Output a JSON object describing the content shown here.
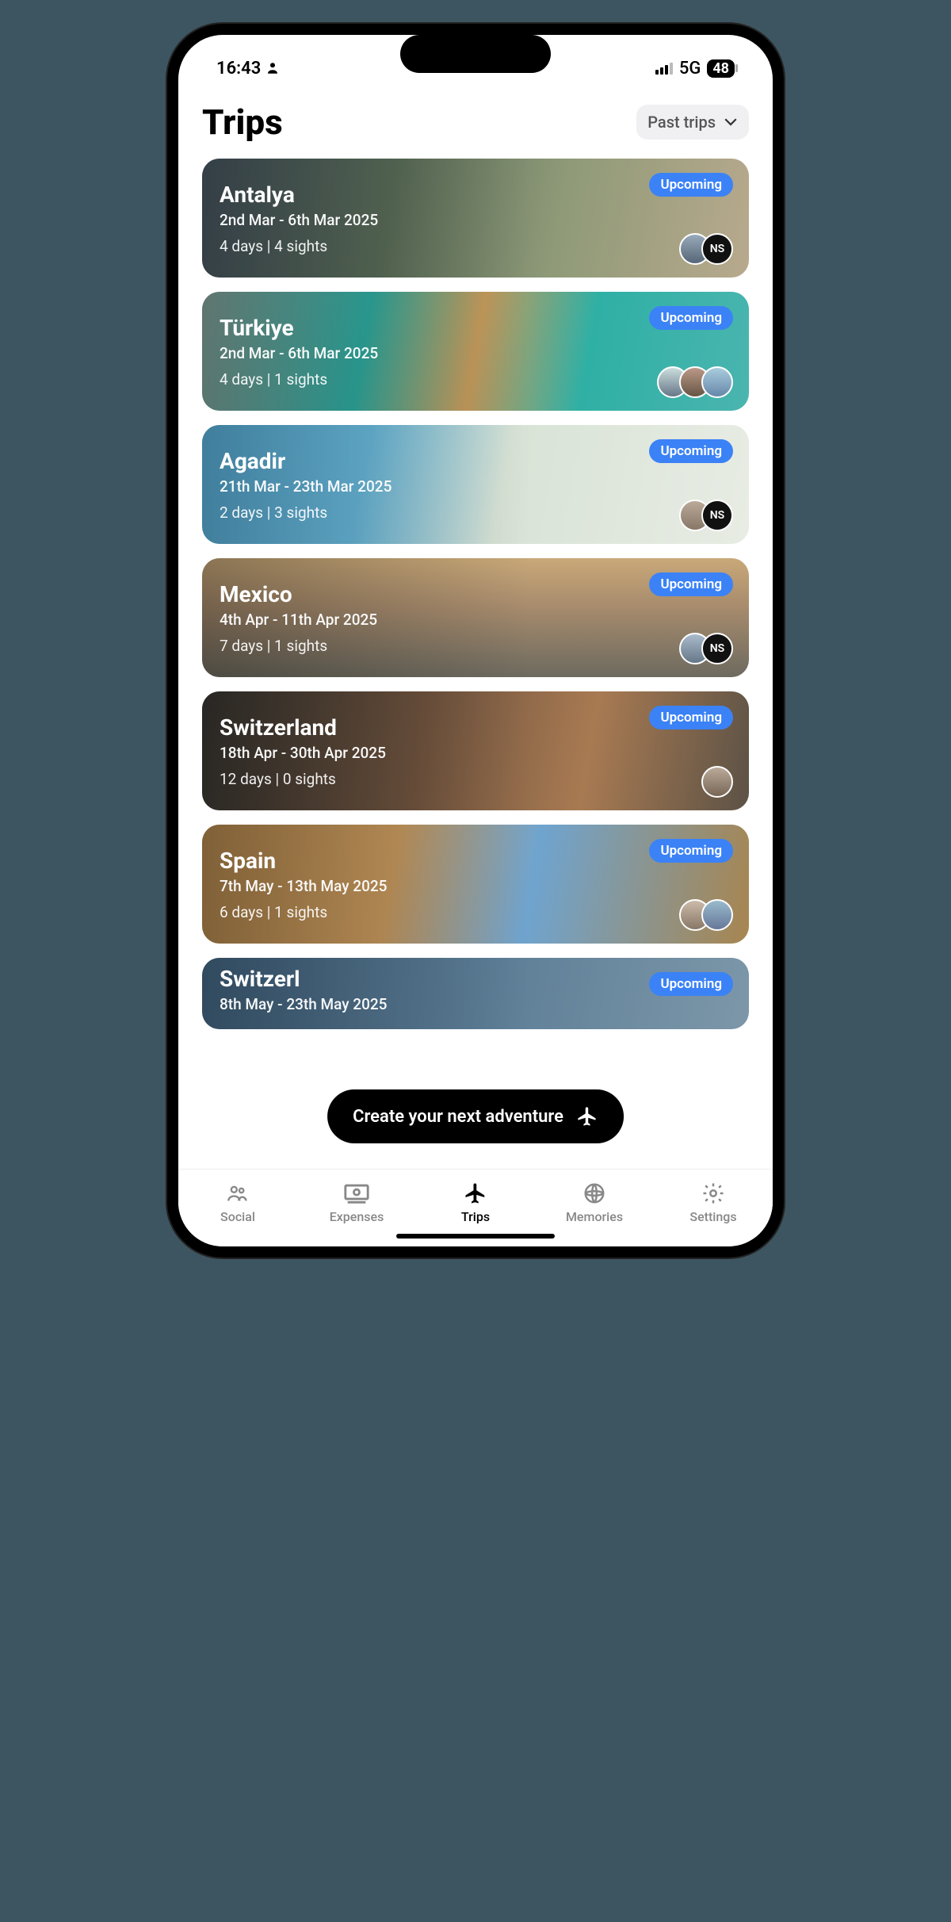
{
  "status": {
    "time": "16:43",
    "network": "5G",
    "battery": "48"
  },
  "header": {
    "title": "Trips",
    "filter_label": "Past trips"
  },
  "trips": [
    {
      "title": "Antalya",
      "dates": "2nd Mar - 6th Mar 2025",
      "meta": "4 days | 4 sights",
      "status": "Upcoming",
      "avatars": [
        {
          "type": "img"
        },
        {
          "type": "initials",
          "text": "NS"
        }
      ]
    },
    {
      "title": "Türkiye",
      "dates": "2nd Mar - 6th Mar 2025",
      "meta": "4 days | 1 sights",
      "status": "Upcoming",
      "avatars": [
        {
          "type": "img"
        },
        {
          "type": "img"
        },
        {
          "type": "img"
        }
      ]
    },
    {
      "title": "Agadir",
      "dates": "21th Mar - 23th Mar 2025",
      "meta": "2 days | 3 sights",
      "status": "Upcoming",
      "avatars": [
        {
          "type": "img"
        },
        {
          "type": "initials",
          "text": "NS"
        }
      ]
    },
    {
      "title": "Mexico",
      "dates": "4th Apr - 11th Apr 2025",
      "meta": "7 days | 1 sights",
      "status": "Upcoming",
      "avatars": [
        {
          "type": "img"
        },
        {
          "type": "initials",
          "text": "NS"
        }
      ]
    },
    {
      "title": "Switzerland",
      "dates": "18th Apr - 30th Apr 2025",
      "meta": "12 days | 0 sights",
      "status": "Upcoming",
      "avatars": [
        {
          "type": "img"
        }
      ]
    },
    {
      "title": "Spain",
      "dates": "7th May - 13th May 2025",
      "meta": "6 days | 1 sights",
      "status": "Upcoming",
      "avatars": [
        {
          "type": "img"
        },
        {
          "type": "img"
        }
      ]
    },
    {
      "title": "Switzerl",
      "dates": "8th May - 23th May 2025",
      "meta": "",
      "status": "Upcoming",
      "avatars": []
    }
  ],
  "fab": {
    "label": "Create your next adventure"
  },
  "tabs": {
    "social": "Social",
    "expenses": "Expenses",
    "trips": "Trips",
    "memories": "Memories",
    "settings": "Settings"
  },
  "colors": {
    "accent": "#3b82f6"
  }
}
